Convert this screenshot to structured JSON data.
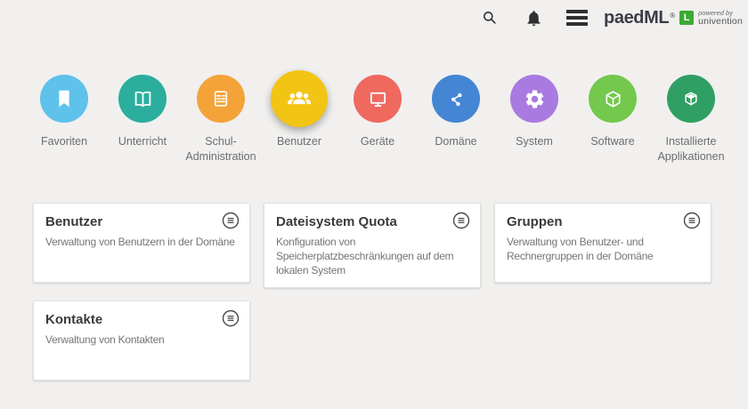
{
  "topbar": {
    "search_icon": "search",
    "notifications_icon": "notifications",
    "menu_icon": "menu",
    "logo": {
      "brand": "paedML",
      "registered": "®",
      "edition_letter": "L",
      "edition_color": "#3caa35",
      "powered_by": "powered by",
      "vendor": "univention"
    }
  },
  "categories": [
    {
      "label": "Favoriten",
      "color": "#5ec2ea",
      "selected": false
    },
    {
      "label": "Unterricht",
      "color": "#2bae9d",
      "selected": false
    },
    {
      "label": "Schul-Administration",
      "color": "#f4a339",
      "selected": false
    },
    {
      "label": "Benutzer",
      "color": "#f2c413",
      "selected": true
    },
    {
      "label": "Geräte",
      "color": "#f0695f",
      "selected": false
    },
    {
      "label": "Domäne",
      "color": "#4486d4",
      "selected": false
    },
    {
      "label": "System",
      "color": "#a97ae0",
      "selected": false
    },
    {
      "label": "Software",
      "color": "#74c84e",
      "selected": false
    },
    {
      "label": "Installierte Applikationen",
      "color": "#309f63",
      "selected": false
    }
  ],
  "modules": [
    {
      "title": "Benutzer",
      "description": "Verwaltung von Benutzern in der Domäne"
    },
    {
      "title": "Dateisystem Quota",
      "description": "Konfiguration von\nSpeicherplatzbeschränkungen auf dem\nlokalen System"
    },
    {
      "title": "Gruppen",
      "description": "Verwaltung von Benutzer- und\nRechnergruppen in der Domäne"
    },
    {
      "title": "Kontakte",
      "description": "Verwaltung von Kontakten"
    }
  ]
}
